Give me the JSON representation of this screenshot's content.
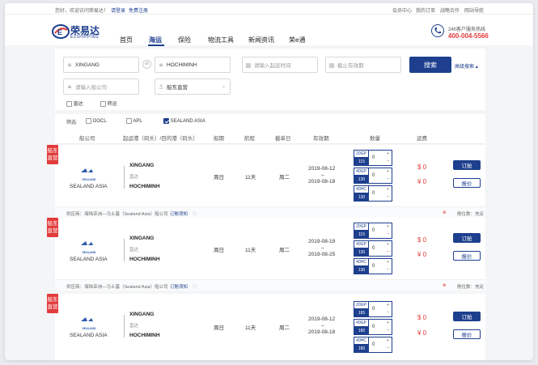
{
  "topbar": {
    "welcome": "您好，欢迎访问荣易达！",
    "login": "请登录",
    "register": "免费注册",
    "links": [
      "会员中心",
      "我的订单",
      "战略合作",
      "网站导航"
    ]
  },
  "brand": {
    "name": "荣易达",
    "sub": "EZSHIPPING"
  },
  "nav": {
    "items": [
      "首页",
      "海运",
      "保险",
      "物流工具",
      "新闻资讯",
      "荣e通"
    ],
    "hotline_label": "24h客户服务热线",
    "hotline_number": "400-004-5566"
  },
  "search": {
    "origin": "XINGANG",
    "destination": "HOCHIMINH",
    "depart_placeholder": "请输入起运时间",
    "deadline_placeholder": "截止有效期",
    "button": "搜索",
    "advanced": "高级搜索",
    "carrier_placeholder": "请输入船公司",
    "source_select": "船东直营",
    "direct": "直达",
    "transfer": "转运"
  },
  "filter": {
    "label": "筛选:",
    "options": [
      {
        "label": "OOCL",
        "checked": false
      },
      {
        "label": "APL",
        "checked": false
      },
      {
        "label": "SEALAND ASIA",
        "checked": true
      }
    ]
  },
  "table_headers": [
    "船公司",
    "起运港（码头）/目的港（码头）",
    "船期",
    "航程",
    "截单日",
    "有效期",
    "数量",
    "运费"
  ],
  "rows": [
    {
      "badge": "船东直营",
      "carrier": "SEALAND ASIA",
      "logo_text": "SEALAND",
      "origin": "XINGANG",
      "route_type": "直达",
      "destination": "HOCHIMINH",
      "sailing_day": "周日",
      "transit": "11天",
      "cutoff": "周二",
      "valid_from": "2019-08-12",
      "valid_sep": "–",
      "valid_to": "2019-08-18",
      "containers": [
        {
          "type": "20GP",
          "qty": "115",
          "count": "0"
        },
        {
          "type": "40GP",
          "qty": "130",
          "count": "0"
        },
        {
          "type": "40HC",
          "qty": "130",
          "count": "0"
        }
      ],
      "price_usd": "$ 0",
      "price_cny": "¥ 0",
      "book": "订舱",
      "quote": "报价",
      "supplier": "供应商：海陆亚洲—马士基（Sealand Asia）船公司",
      "notice": "订舱须知",
      "space": "舱位数：充足"
    },
    {
      "badge": "船东直营",
      "carrier": "SEALAND ASIA",
      "logo_text": "SEALAND",
      "origin": "XINGANG",
      "route_type": "直达",
      "destination": "HOCHIMINH",
      "sailing_day": "周日",
      "transit": "11天",
      "cutoff": "周二",
      "valid_from": "2019-08-19",
      "valid_sep": "–",
      "valid_to": "2019-08-25",
      "containers": [
        {
          "type": "20GP",
          "qty": "115",
          "count": "0"
        },
        {
          "type": "40GP",
          "qty": "130",
          "count": "0"
        },
        {
          "type": "40HC",
          "qty": "130",
          "count": "0"
        }
      ],
      "price_usd": "$ 0",
      "price_cny": "¥ 0",
      "book": "订舱",
      "quote": "报价",
      "supplier": "供应商：海陆亚洲—马士基（Sealand Asia）船公司",
      "notice": "订舱须知",
      "space": "舱位数：充足"
    },
    {
      "badge": "船东直营",
      "carrier": "SEALAND ASIA",
      "logo_text": "SEALAND",
      "origin": "XINGANG",
      "route_type": "直达",
      "destination": "HOCHIMINH",
      "sailing_day": "周日",
      "transit": "11天",
      "cutoff": "周二",
      "valid_from": "2019-08-12",
      "valid_sep": "–",
      "valid_to": "2019-08-18",
      "containers": [
        {
          "type": "20GP",
          "qty": "165",
          "count": "0"
        },
        {
          "type": "40GP",
          "qty": "180",
          "count": "0"
        },
        {
          "type": "40HC",
          "qty": "180",
          "count": "0"
        }
      ],
      "price_usd": "$ 0",
      "price_cny": "¥ 0",
      "book": "订舱",
      "quote": "报价"
    }
  ],
  "colors": {
    "brand": "#1d3f8e",
    "accent": "#e23b3b"
  }
}
